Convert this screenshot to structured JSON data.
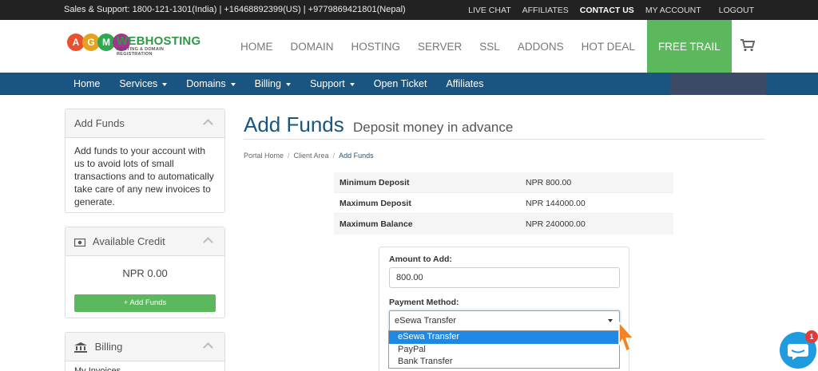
{
  "topbar": {
    "support": "Sales & Support: 1800-121-1301(India) | +16468892399(US) | +9779869421801(Nepal)",
    "links": [
      "LIVE CHAT",
      "AFFILIATES",
      "CONTACT US",
      "MY ACCOUNT",
      "LOGOUT"
    ]
  },
  "logo": {
    "letters": [
      "A",
      "G",
      "M"
    ],
    "brand": "WEBHOSTING",
    "tagline": "HOSTING & DOMAIN REGISTRATION"
  },
  "mainnav": [
    "HOME",
    "DOMAIN",
    "HOSTING",
    "SERVER",
    "SSL",
    "ADDONS",
    "HOT DEAL",
    "FREE TRAIL"
  ],
  "bluenav": {
    "home": "Home",
    "services": "Services",
    "domains": "Domains",
    "billing": "Billing",
    "support": "Support",
    "open_ticket": "Open Ticket",
    "affiliates": "Affiliates"
  },
  "sidebar": {
    "add_funds": {
      "title": "Add Funds",
      "text": "Add funds to your account with us to avoid lots of small transactions and to automatically take care of any new invoices to generate."
    },
    "credit": {
      "title": "Available Credit",
      "amount": "NPR 0.00",
      "button": "+ Add Funds"
    },
    "billing": {
      "title": "Billing",
      "first_item": "My Invoices"
    }
  },
  "page": {
    "title": "Add Funds",
    "subtitle": "Deposit money in advance",
    "breadcrumb": [
      "Portal Home",
      "Client Area",
      "Add Funds"
    ]
  },
  "limits": [
    {
      "label": "Minimum Deposit",
      "value": "NPR 800.00"
    },
    {
      "label": "Maximum Deposit",
      "value": "NPR 144000.00"
    },
    {
      "label": "Maximum Balance",
      "value": "NPR 240000.00"
    }
  ],
  "form": {
    "amount_label": "Amount to Add:",
    "amount_value": "800.00",
    "method_label": "Payment Method:",
    "method_selected": "eSewa Transfer",
    "method_options": [
      "eSewa Transfer",
      "PayPal",
      "Bank Transfer"
    ]
  },
  "chat": {
    "badge": "1"
  },
  "colors": {
    "primary_blue": "#1a5582",
    "accent_green": "#5cb85c",
    "select_highlight": "#1e88e5",
    "chat_blue": "#1f9be0",
    "cursor_orange": "#f58220"
  }
}
